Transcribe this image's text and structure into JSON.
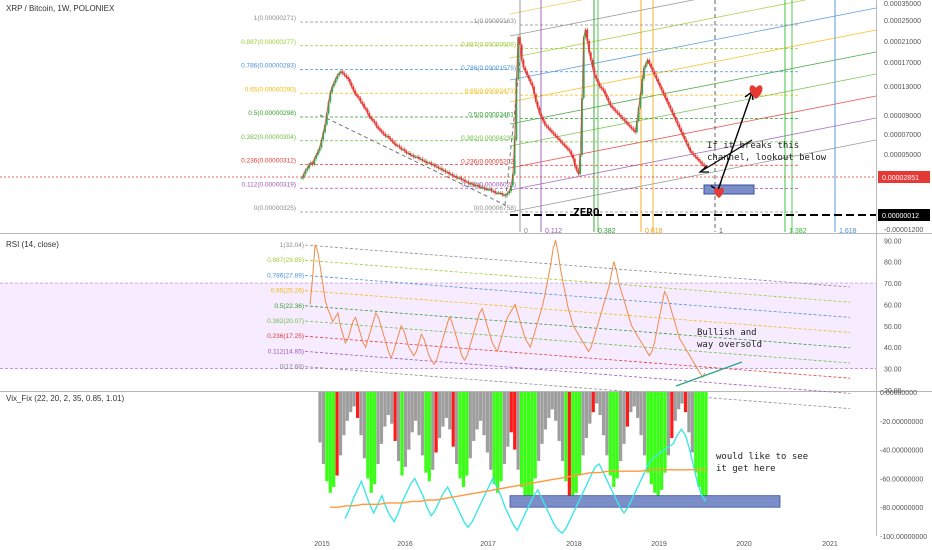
{
  "header": {
    "title": "XRP / Bitcoin, 1W, POLONIEX"
  },
  "rsi_pane": {
    "title": "RSI (14, close)"
  },
  "vix_pane": {
    "title": "Vix_Fix (22, 20, 2, 35, 0.85, 1.01)"
  },
  "annotations": {
    "zero_label": "ZERO",
    "channel_note": "If it breaks this\nchannel, lookout below",
    "rsi_note": "Bullish and\nway oversold",
    "vix_note": "would like to see\nit get here"
  },
  "colors": {
    "candle_up": "#33a852",
    "candle_down": "#e53935",
    "rsi_line": "#f08a4b",
    "vix_bar_gray": "#9e9e9e",
    "vix_bar_green": "#39ff14",
    "vix_bar_red": "#ff1a1a",
    "vix_cyan": "#3ee6e6",
    "vix_orange": "#ff9a3c",
    "target_box": "#7b8ec9",
    "price_label": "#e53935"
  },
  "chart_data": [
    {
      "type": "line",
      "pane": "price",
      "title": "XRP / Bitcoin, 1W, POLONIEX",
      "y_scale": "log",
      "y_ticks": [
        "0.00035000",
        "0.00025000",
        "0.00021000",
        "0.00017000",
        "0.00013000",
        "0.00009000",
        "0.00007000",
        "0.00005000",
        "0.00002851",
        "0.00000012",
        "-0.00001200"
      ],
      "x_ticks": [
        "2015",
        "2016",
        "2017",
        "2018",
        "2019",
        "2020",
        "2021"
      ],
      "last_price": "0.00002851",
      "zero_price": "0.00000012",
      "fib_retracement_left": [
        {
          "level": "1(0.00000271)",
          "color": "#8c8c8c"
        },
        {
          "level": "0.887(0.00000277)",
          "color": "#9acd32"
        },
        {
          "level": "0.786(0.00000283)",
          "color": "#4a90d9"
        },
        {
          "level": "0.65(0.00000290)",
          "color": "#f5b90a"
        },
        {
          "level": "0.5(0.00000298)",
          "color": "#2e9e2e"
        },
        {
          "level": "0.382(0.00000304)",
          "color": "#6abf40"
        },
        {
          "level": "0.236(0.00000312)",
          "color": "#e53935"
        },
        {
          "level": "0.112(0.00000319)",
          "color": "#9b59b6"
        },
        {
          "level": "0(0.00000325)",
          "color": "#8c8c8c"
        }
      ],
      "fib_retracement_right": [
        {
          "level": "1(0.00000163)",
          "color": "#8c8c8c"
        },
        {
          "level": "0.887(0.00000908)",
          "color": "#9acd32"
        },
        {
          "level": "0.786(0.00001575)",
          "color": "#4a90d9"
        },
        {
          "level": "0.65(0.00002471)",
          "color": "#f5b90a"
        },
        {
          "level": "0.5(0.00003461)",
          "color": "#2e9e2e"
        },
        {
          "level": "0.382(0.00004239)",
          "color": "#6abf40"
        },
        {
          "level": "0.236(0.00005202)",
          "color": "#e53935"
        },
        {
          "level": "0.112(0.00006020)",
          "color": "#9b59b6"
        },
        {
          "level": "0(0.00006758)",
          "color": "#8c8c8c"
        }
      ],
      "fib_time_zones": [
        {
          "label": "0",
          "color": "#8c8c8c"
        },
        {
          "label": "0.112",
          "color": "#9b59b6"
        },
        {
          "label": "0.382",
          "color": "#2e9e2e"
        },
        {
          "label": "0.618",
          "color": "#f5a20a"
        },
        {
          "label": "1",
          "color": "#555555"
        },
        {
          "label": "1.382",
          "color": "#2ebd2e"
        },
        {
          "label": "1.618",
          "color": "#4a90d9"
        }
      ],
      "price_series": [
        18,
        20,
        22,
        23,
        25,
        26,
        25,
        28,
        30,
        32,
        34,
        38,
        42,
        46,
        52,
        58,
        63,
        66,
        68,
        70,
        72,
        73,
        74,
        73,
        72,
        71,
        70,
        68,
        66,
        64,
        62,
        61,
        60,
        58,
        57,
        55,
        54,
        52,
        50,
        49,
        48,
        47,
        45,
        44,
        43,
        42,
        41,
        40,
        40,
        39,
        38,
        37,
        36,
        35,
        35,
        34,
        33,
        33,
        32,
        31,
        31,
        30,
        30,
        29,
        29,
        29,
        28,
        28,
        27,
        27,
        26,
        26,
        26,
        25,
        25,
        24,
        24,
        23,
        23,
        22,
        22,
        21,
        21,
        20,
        20,
        19,
        19,
        18,
        18,
        18,
        17,
        17,
        16,
        16,
        15,
        15,
        15,
        14,
        14,
        14,
        13,
        13,
        13,
        12,
        12,
        12,
        12,
        11,
        11,
        10,
        10,
        10,
        10,
        9,
        9,
        9,
        10,
        11,
        14,
        20,
        38,
        70,
        92,
        88,
        80,
        76,
        74,
        72,
        70,
        68,
        66,
        62,
        58,
        55,
        52,
        50,
        48,
        46,
        45,
        44,
        43,
        42,
        41,
        40,
        39,
        38,
        37,
        36,
        35,
        34,
        33,
        32,
        30,
        28,
        24,
        22,
        20,
        30,
        60,
        92,
        96,
        90,
        84,
        80,
        76,
        72,
        70,
        68,
        66,
        65,
        64,
        62,
        60,
        58,
        56,
        55,
        54,
        53,
        52,
        51,
        50,
        49,
        48,
        47,
        46,
        45,
        44,
        43,
        42,
        48,
        55,
        62,
        70,
        76,
        78,
        80,
        78,
        76,
        74,
        72,
        70,
        68,
        66,
        64,
        62,
        60,
        58,
        56,
        54,
        52,
        50,
        48,
        46,
        44,
        42,
        40,
        38,
        36,
        34,
        32,
        31,
        30,
        29,
        28,
        27,
        26,
        25,
        24,
        24
      ]
    },
    {
      "type": "line",
      "pane": "rsi",
      "title": "RSI (14, close)",
      "y_ticks": [
        90,
        80,
        70,
        60,
        50,
        40,
        30,
        20
      ],
      "ylim": [
        20,
        92
      ],
      "overbought": 70,
      "oversold": 30,
      "fib_levels": [
        {
          "label": "1(32.04)",
          "color": "#8c8c8c"
        },
        {
          "label": "0.887(29.85)",
          "color": "#9acd32"
        },
        {
          "label": "0.786(27.89)",
          "color": "#4a90d9"
        },
        {
          "label": "0.65(25.26)",
          "color": "#f5b90a"
        },
        {
          "label": "0.5(22.36)",
          "color": "#2e9e2e"
        },
        {
          "label": "0.382(20.07)",
          "color": "#6abf40"
        },
        {
          "label": "0.236(17.25)",
          "color": "#e53935"
        },
        {
          "label": "0.112(14.85)",
          "color": "#9b59b6"
        },
        {
          "label": "0(12.68)",
          "color": "#8c8c8c"
        }
      ],
      "values": [
        60,
        72,
        88,
        85,
        78,
        70,
        62,
        58,
        55,
        52,
        54,
        56,
        50,
        46,
        42,
        44,
        48,
        52,
        54,
        50,
        46,
        42,
        40,
        44,
        48,
        52,
        56,
        54,
        50,
        46,
        42,
        38,
        35,
        38,
        42,
        46,
        50,
        48,
        44,
        40,
        38,
        36,
        38,
        42,
        46,
        44,
        40,
        36,
        34,
        32,
        34,
        38,
        42,
        46,
        50,
        54,
        52,
        48,
        44,
        40,
        36,
        34,
        36,
        40,
        44,
        48,
        52,
        56,
        58,
        54,
        50,
        46,
        42,
        40,
        38,
        42,
        46,
        50,
        54,
        56,
        58,
        60,
        56,
        52,
        48,
        44,
        42,
        40,
        44,
        48,
        52,
        56,
        60,
        66,
        72,
        78,
        86,
        90,
        84,
        76,
        70,
        64,
        58,
        54,
        50,
        48,
        46,
        44,
        42,
        40,
        38,
        40,
        44,
        48,
        52,
        56,
        60,
        64,
        68,
        74,
        80,
        76,
        70,
        66,
        62,
        58,
        54,
        50,
        48,
        46,
        44,
        42,
        40,
        38,
        36,
        38,
        42,
        48,
        54,
        60,
        66,
        64,
        60,
        56,
        52,
        48,
        44,
        42,
        40,
        38,
        36,
        34,
        32,
        30,
        28,
        26,
        28
      ]
    },
    {
      "type": "bar",
      "pane": "vix_fix",
      "title": "Vix_Fix (22, 20, 2, 35, 0.85, 1.01)",
      "y_ticks": [
        "0.00000000",
        "-20.00000000",
        "-40.00000000",
        "-60.00000000",
        "-80.00000000",
        "-100.00000000"
      ],
      "ylim": [
        -100,
        0
      ],
      "target_zone": [
        -72,
        -80
      ],
      "bar_values": [
        -35,
        -50,
        -62,
        -70,
        -66,
        -58,
        -44,
        -30,
        -20,
        -14,
        -10,
        -18,
        -30,
        -46,
        -60,
        -70,
        -64,
        -50,
        -36,
        -24,
        -16,
        -22,
        -34,
        -48,
        -58,
        -52,
        -40,
        -28,
        -20,
        -30,
        -44,
        -56,
        -62,
        -54,
        -42,
        -32,
        -24,
        -18,
        -26,
        -38,
        -50,
        -60,
        -66,
        -58,
        -46,
        -34,
        -26,
        -20,
        -30,
        -42,
        -54,
        -64,
        -70,
        -62,
        -50,
        -38,
        -28,
        -40,
        -54,
        -66,
        -74,
        -80,
        -72,
        -60,
        -48,
        -36,
        -26,
        -18,
        -12,
        -20,
        -34,
        -48,
        -62,
        -72,
        -78,
        -70,
        -58,
        -44,
        -32,
        -22,
        -14,
        -8,
        -16,
        -30,
        -44,
        -58,
        -66,
        -60,
        -48,
        -36,
        -24,
        -14,
        -10,
        -18,
        -30,
        -44,
        -56,
        -64,
        -70,
        -74,
        -68,
        -56,
        -44,
        -32,
        -20,
        -12,
        -8,
        -14,
        -28,
        -42,
        -56,
        -66,
        -72,
        -76
      ],
      "series": [
        {
          "name": "",
          "color": "#3ee6e6",
          "values": [
            -88,
            -82,
            -74,
            -68,
            -62,
            -70,
            -78,
            -84,
            -78,
            -72,
            -80,
            -86,
            -90,
            -84,
            -76,
            -70,
            -64,
            -60,
            -66,
            -72,
            -80,
            -86,
            -82,
            -76,
            -70,
            -66,
            -72,
            -78,
            -84,
            -90,
            -94,
            -90,
            -84,
            -78,
            -72,
            -66,
            -60,
            -66,
            -72,
            -80,
            -86,
            -92,
            -96,
            -90,
            -84,
            -78,
            -72,
            -68,
            -74,
            -80,
            -86,
            -92,
            -96,
            -98,
            -94,
            -88,
            -82,
            -76,
            -70,
            -64,
            -58,
            -52,
            -50,
            -56,
            -62,
            -68,
            -74,
            -80,
            -84,
            -80,
            -74,
            -68,
            -62,
            -56,
            -50,
            -46,
            -44,
            -42,
            -40,
            -38,
            -36,
            -30,
            -26,
            -30,
            -40,
            -52,
            -64,
            -72,
            -76
          ]
        },
        {
          "name": "",
          "color": "#ff9a3c",
          "values": [
            -80,
            -80,
            -79,
            -79,
            -78,
            -78,
            -78,
            -77,
            -77,
            -77,
            -76,
            -76,
            -75,
            -75,
            -74,
            -73,
            -72,
            -71,
            -70,
            -69,
            -68,
            -67,
            -66,
            -65,
            -64,
            -63,
            -62,
            -61,
            -60,
            -59,
            -58,
            -57,
            -56,
            -56,
            -55,
            -55,
            -55,
            -55,
            -55,
            -54,
            -54,
            -54,
            -54,
            -54,
            -54,
            -54,
            -54
          ]
        }
      ]
    }
  ]
}
